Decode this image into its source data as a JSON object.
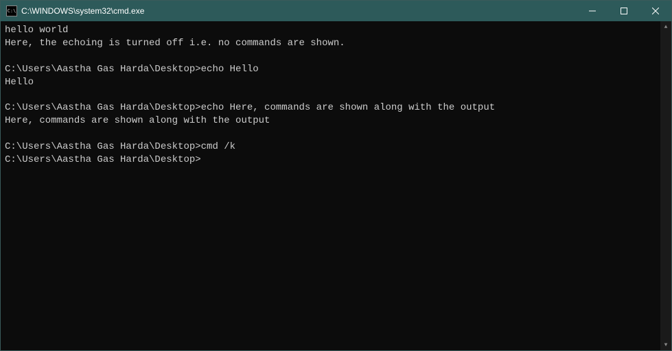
{
  "window": {
    "title": "C:\\WINDOWS\\system32\\cmd.exe",
    "icon_text": "C:\\"
  },
  "terminal": {
    "lines": [
      "hello world",
      "Here, the echoing is turned off i.e. no commands are shown.",
      "",
      "C:\\Users\\Aastha Gas Harda\\Desktop>echo Hello",
      "Hello",
      "",
      "C:\\Users\\Aastha Gas Harda\\Desktop>echo Here, commands are shown along with the output",
      "Here, commands are shown along with the output",
      "",
      "C:\\Users\\Aastha Gas Harda\\Desktop>cmd /k",
      "C:\\Users\\Aastha Gas Harda\\Desktop>"
    ]
  }
}
